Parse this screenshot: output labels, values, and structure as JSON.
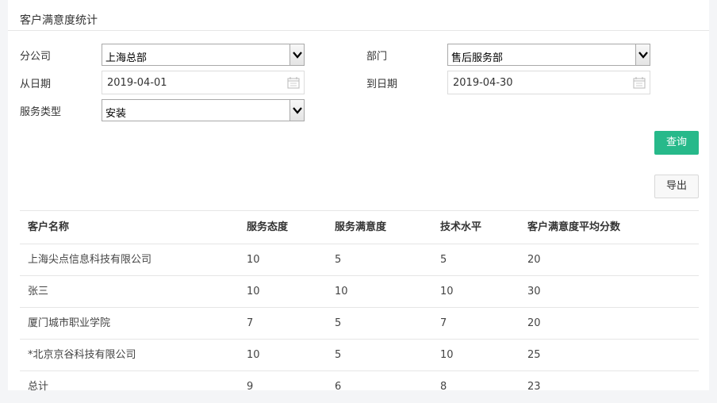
{
  "page_title": "客户满意度统计",
  "form": {
    "branch_label": "分公司",
    "branch_value": "上海总部",
    "dept_label": "部门",
    "dept_value": "售后服务部",
    "from_label": "从日期",
    "from_value": "2019-04-01",
    "to_label": "到日期",
    "to_value": "2019-04-30",
    "service_label": "服务类型",
    "service_value": "安装"
  },
  "buttons": {
    "query": "查询",
    "export": "导出"
  },
  "table": {
    "headers": [
      "客户名称",
      "服务态度",
      "服务满意度",
      "技术水平",
      "客户满意度平均分数"
    ],
    "rows": [
      [
        "上海尖点信息科技有限公司",
        "10",
        "5",
        "5",
        "20"
      ],
      [
        "张三",
        "10",
        "10",
        "10",
        "30"
      ],
      [
        "厦门城市职业学院",
        "7",
        "5",
        "7",
        "20"
      ],
      [
        "*北京京谷科技有限公司",
        "10",
        "5",
        "10",
        "25"
      ],
      [
        "总计",
        "9",
        "6",
        "8",
        "23"
      ]
    ]
  },
  "colors": {
    "primary": "#27b98a",
    "background": "#f4f5f7"
  }
}
